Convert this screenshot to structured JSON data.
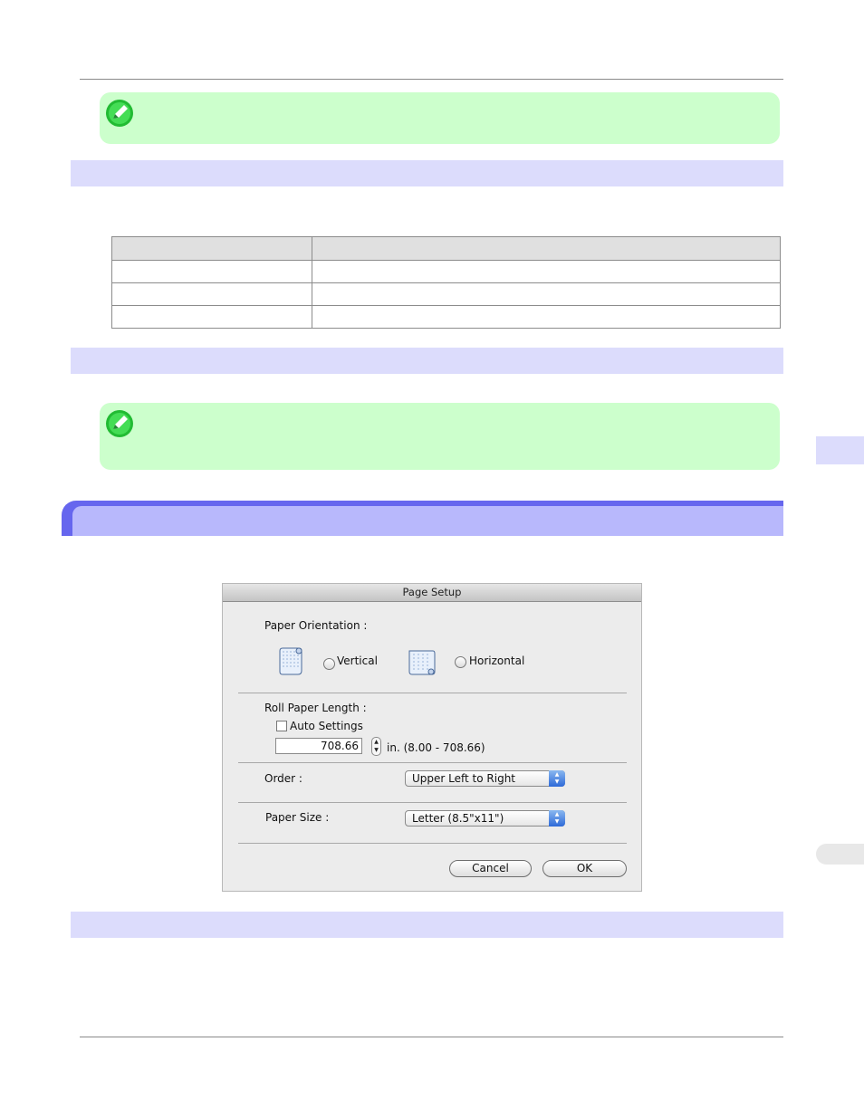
{
  "dialog": {
    "title": "Page Setup",
    "orientation": {
      "label": "Paper Orientation :",
      "vertical": "Vertical",
      "horizontal": "Horizontal"
    },
    "roll_length": {
      "label": "Roll Paper Length :",
      "auto_settings": "Auto Settings",
      "value": "708.66",
      "range": "in. (8.00 - 708.66)"
    },
    "order": {
      "label": "Order :",
      "selected": "Upper Left to Right"
    },
    "paper_size": {
      "label": "Paper Size :",
      "selected": "Letter (8.5\"x11\")"
    },
    "buttons": {
      "cancel": "Cancel",
      "ok": "OK"
    }
  },
  "colors": {
    "note_bg": "#ccffcc",
    "band_bg": "#dcdcfc",
    "chapter_dark": "#6666ee",
    "chapter_light": "#b8b8fc"
  },
  "icons": [
    "note-pencil-icon",
    "note-pencil-icon",
    "vertical-roll-icon",
    "horizontal-roll-icon"
  ]
}
